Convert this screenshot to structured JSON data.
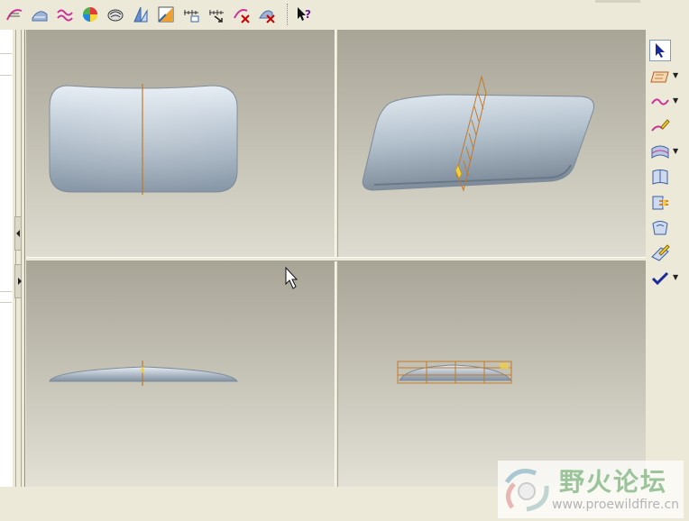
{
  "toolbar": {
    "items": [
      {
        "name": "curve-sketch-icon",
        "color": "#cc3399"
      },
      {
        "name": "surface-analysis-icon",
        "color": "#4a6fb0"
      },
      {
        "name": "curvature-wave-icon",
        "color": "#cc3399"
      },
      {
        "name": "color-shading-icon",
        "color": "#3a8f3a"
      },
      {
        "name": "reflection-analysis-icon",
        "color": "#333333"
      },
      {
        "name": "draft-analysis-icon",
        "color": "#3366aa"
      },
      {
        "name": "slope-analysis-icon",
        "color": "#cc6600"
      },
      {
        "name": "section-measure-icon",
        "color": "#333333"
      },
      {
        "name": "offset-measure-icon",
        "color": "#333333"
      },
      {
        "name": "delete-curve-analysis-icon",
        "color": "#cc0000"
      },
      {
        "name": "delete-surface-analysis-icon",
        "color": "#cc0000"
      }
    ],
    "help_icon": "context-help-icon"
  },
  "right_toolbar": {
    "items": [
      {
        "name": "select-pointer-icon",
        "active": true,
        "dropdown": false
      },
      {
        "name": "datum-plane-icon",
        "active": false,
        "dropdown": true
      },
      {
        "name": "style-curve-icon",
        "active": false,
        "dropdown": true
      },
      {
        "name": "edit-curve-icon",
        "active": false,
        "dropdown": false
      },
      {
        "name": "boundary-surface-icon",
        "active": false,
        "dropdown": true
      },
      {
        "name": "surface-connect-icon",
        "active": false,
        "dropdown": false
      },
      {
        "name": "trim-surface-icon",
        "active": false,
        "dropdown": false
      },
      {
        "name": "surface-edit-icon",
        "active": false,
        "dropdown": false
      },
      {
        "name": "curve-on-surface-icon",
        "active": false,
        "dropdown": false
      },
      {
        "name": "done-check-icon",
        "active": false,
        "dropdown": true
      }
    ]
  },
  "viewports": [
    {
      "name": "viewport-top-view"
    },
    {
      "name": "viewport-3d-view"
    },
    {
      "name": "viewport-front-view"
    },
    {
      "name": "viewport-right-view"
    }
  ],
  "colors": {
    "model_fill": "#b8c6d2",
    "model_edge": "#7d8a98",
    "section_line": "#c07a2c",
    "highlight": "#f0d040",
    "bg_top": "#a8a597",
    "bg_bottom": "#e3e1d6"
  },
  "watermark": {
    "title": "野火论坛",
    "url": "www.proewildfire.cn"
  }
}
